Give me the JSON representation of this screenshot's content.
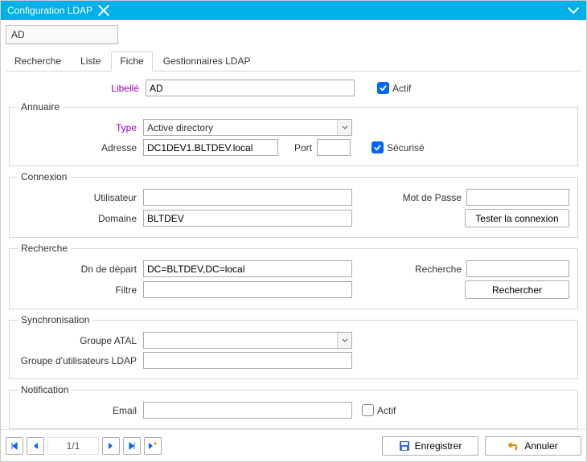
{
  "window": {
    "title": "Configuration LDAP"
  },
  "record": {
    "name": "AD"
  },
  "tabs": [
    "Recherche",
    "Liste",
    "Fiche",
    "Gestionnaires LDAP"
  ],
  "selectedTab": "Fiche",
  "labels": {
    "libelle": "Libellé",
    "actif": "Actif",
    "annuaire": "Annuaire",
    "type": "Type",
    "adresse": "Adresse",
    "port": "Port",
    "securise": "Sécurisé",
    "connexion": "Connexion",
    "utilisateur": "Utilisateur",
    "mdp": "Mot de Passe",
    "domaine": "Domaine",
    "tester": "Tester la connexion",
    "recherche": "Recherche",
    "dn": "Dn de départ",
    "filtre": "Filtre",
    "recherche_lbl": "Recherche",
    "rechercher": "Rechercher",
    "sync": "Synchronisation",
    "groupe_atal": "Groupe ATAL",
    "groupe_ldap": "Groupe d'utilisateurs LDAP",
    "notification": "Notification",
    "email": "Email",
    "actif_email": "Actif"
  },
  "values": {
    "libelle": "AD",
    "actif": true,
    "type": "Active directory",
    "adresse": "DC1DEV1.BLTDEV.local",
    "port": "",
    "securise": true,
    "utilisateur": "",
    "mdp": "",
    "domaine": "BLTDEV",
    "dn": "DC=BLTDEV,DC=local",
    "filtre": "",
    "recherche": "",
    "groupe_atal": "",
    "groupe_ldap": "",
    "email": "",
    "actif_email": false
  },
  "pager": {
    "text": "1/1"
  },
  "footer": {
    "save": "Enregistrer",
    "cancel": "Annuler"
  }
}
